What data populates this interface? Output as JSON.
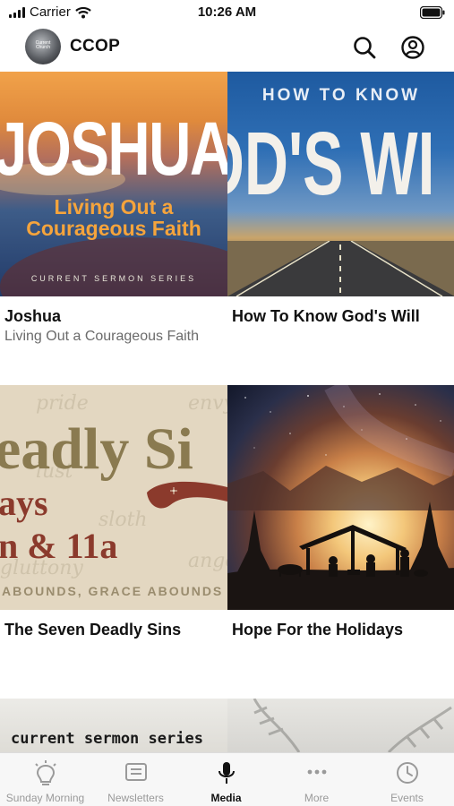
{
  "status_bar": {
    "carrier": "Carrier",
    "time": "10:26 AM"
  },
  "header": {
    "app_name": "CCOP",
    "logo_text": "Current Church",
    "icons": {
      "search": "search-icon",
      "account": "account-circle-icon"
    }
  },
  "series": [
    {
      "title": "Joshua",
      "subtitle": "Living Out a Courageous Faith",
      "art": {
        "headline": "JOSHUA",
        "line1": "Living Out a",
        "line2": "Courageous Faith",
        "footer": "CURRENT SERMON SERIES"
      }
    },
    {
      "title": "How To Know God's Will",
      "subtitle": "",
      "art": {
        "top": "HOW TO KNOW",
        "headline": "OD'S WI"
      }
    },
    {
      "title": "The Seven Deadly Sins",
      "subtitle": "",
      "art": {
        "headline": "eadly Si",
        "line1": "ays",
        "line2": "n & 11a",
        "footer": "ABOUNDS, GRACE ABOUNDS",
        "script": [
          "pride",
          "lust",
          "envy",
          "sloth",
          "gluttony",
          "anger"
        ]
      }
    },
    {
      "title": "Hope For the Holidays",
      "subtitle": ""
    }
  ],
  "third_row": {
    "left_text": "current sermon series"
  },
  "tab_bar": {
    "items": [
      {
        "label": "Sunday Morning",
        "icon": "lightbulb-icon",
        "active": false
      },
      {
        "label": "Newsletters",
        "icon": "newsletter-icon",
        "active": false
      },
      {
        "label": "Media",
        "icon": "microphone-icon",
        "active": true
      },
      {
        "label": "More",
        "icon": "more-dots-icon",
        "active": false
      },
      {
        "label": "Events",
        "icon": "clock-icon",
        "active": false
      }
    ]
  }
}
